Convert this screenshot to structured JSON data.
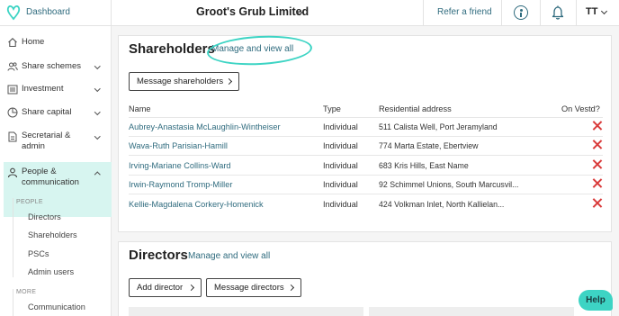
{
  "topbar": {
    "dashboard_label": "Dashboard",
    "company_name": "Groot's Grub Limited",
    "refer_label": "Refer a friend",
    "avatar_initials": "TT"
  },
  "sidebar": {
    "items": [
      {
        "label": "Home",
        "icon": "home-icon"
      },
      {
        "label": "Share schemes",
        "icon": "people-icon"
      },
      {
        "label": "Investment",
        "icon": "building-icon"
      },
      {
        "label": "Share capital",
        "icon": "pie-chart-icon"
      },
      {
        "label": "Secretarial & admin",
        "icon": "document-icon"
      },
      {
        "label": "People & communication",
        "icon": "person-icon"
      }
    ],
    "people_heading": "PEOPLE",
    "people_items": [
      "Directors",
      "Shareholders",
      "PSCs",
      "Admin users"
    ],
    "more_heading": "MORE",
    "more_items": [
      "Communication"
    ]
  },
  "shareholders": {
    "title": "Shareholders",
    "manage_label": "Manage and view all",
    "message_button": "Message shareholders",
    "columns": [
      "Name",
      "Type",
      "Residential address",
      "On Vestd?"
    ],
    "rows": [
      {
        "name": "Aubrey-Anastasia McLaughlin-Wintheiser",
        "type": "Individual",
        "address": "511 Calista Well, Port Jeramyland"
      },
      {
        "name": "Wava-Ruth Parisian-Hamill",
        "type": "Individual",
        "address": "774 Marta Estate, Ebertview"
      },
      {
        "name": "Irving-Mariane Collins-Ward",
        "type": "Individual",
        "address": "683 Kris Hills, East Name"
      },
      {
        "name": "Irwin-Raymond Tromp-Miller",
        "type": "Individual",
        "address": "92 Schimmel Unions, South Marcusvil..."
      },
      {
        "name": "Kellie-Magdalena Corkery-Homenick",
        "type": "Individual",
        "address": "424 Volkman Inlet, North Kallielan..."
      }
    ]
  },
  "directors": {
    "title": "Directors",
    "manage_label": "Manage and view all",
    "add_button": "Add director",
    "message_button": "Message directors"
  },
  "help_label": "Help",
  "colors": {
    "accent": "#3dd4c4",
    "link": "#2f6b7e",
    "active_bg": "#d7f5f0",
    "cross": "#d93a3a"
  }
}
